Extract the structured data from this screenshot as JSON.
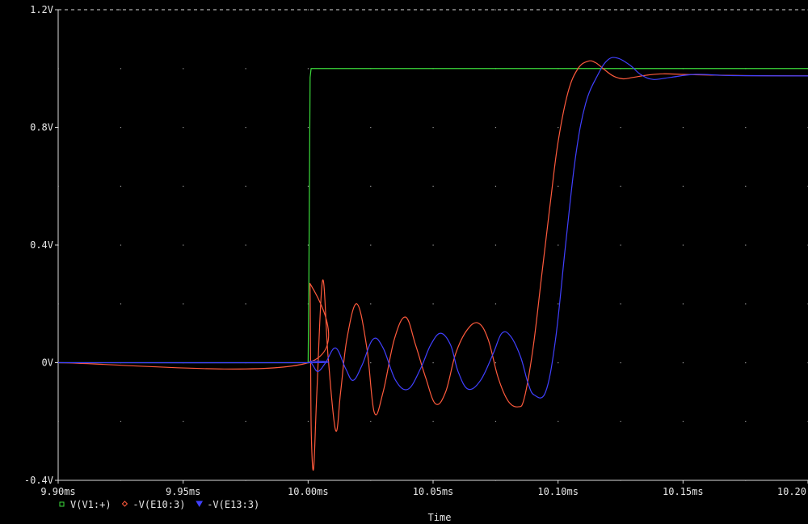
{
  "chart_data": {
    "type": "line",
    "xlabel": "Time",
    "ylabel": "",
    "xlim": [
      9.9,
      10.2
    ],
    "ylim": [
      -0.4,
      1.2
    ],
    "x_ticks": [
      {
        "value": 9.9,
        "label": "9.90ms"
      },
      {
        "value": 9.95,
        "label": "9.95ms"
      },
      {
        "value": 10.0,
        "label": "10.00ms"
      },
      {
        "value": 10.05,
        "label": "10.05ms"
      },
      {
        "value": 10.1,
        "label": "10.10ms"
      },
      {
        "value": 10.15,
        "label": "10.15ms"
      },
      {
        "value": 10.2,
        "label": "10.20"
      }
    ],
    "y_ticks": [
      {
        "value": 1.2,
        "label": "1.2V"
      },
      {
        "value": 0.8,
        "label": "0.8V"
      },
      {
        "value": 0.4,
        "label": "0.4V"
      },
      {
        "value": 0.0,
        "label": "0V"
      },
      {
        "value": -0.4,
        "label": "-0.4V"
      }
    ],
    "grid": true,
    "legend_position": "bottom-left",
    "series": [
      {
        "name": "V(V1:+)",
        "marker": "square",
        "color": "#3cdc3c",
        "x": [
          9.9,
          10.0,
          10.0003,
          10.0008,
          10.0012,
          10.002,
          10.2
        ],
        "y": [
          0.0,
          0.0,
          0.28,
          0.97,
          1.0,
          1.0,
          1.0
        ]
      },
      {
        "name": "-V(E10:3)",
        "marker": "diamond",
        "color": "#ff5a3c",
        "x": [
          9.9,
          10.0,
          10.0007,
          10.001,
          10.0013,
          10.0022,
          10.0035,
          10.0058,
          10.008,
          10.011,
          10.013,
          10.0155,
          10.0195,
          10.0235,
          10.0265,
          10.03,
          10.0345,
          10.039,
          10.043,
          10.047,
          10.051,
          10.055,
          10.059,
          10.0635,
          10.068,
          10.072,
          10.076,
          10.08,
          10.084,
          10.0865,
          10.09,
          10.0935,
          10.097,
          10.1,
          10.104,
          10.108,
          10.112,
          10.115,
          10.118,
          10.122,
          10.126,
          10.13,
          10.136,
          10.142,
          10.15,
          10.16,
          10.175,
          10.2
        ],
        "y": [
          0.0,
          0.0,
          0.27,
          0.0,
          -0.25,
          -0.36,
          -0.1,
          0.28,
          0.02,
          -0.23,
          -0.1,
          0.08,
          0.2,
          0.05,
          -0.17,
          -0.1,
          0.08,
          0.155,
          0.06,
          -0.05,
          -0.14,
          -0.1,
          0.03,
          0.11,
          0.135,
          0.08,
          -0.05,
          -0.13,
          -0.15,
          -0.12,
          0.05,
          0.3,
          0.55,
          0.75,
          0.92,
          1.0,
          1.025,
          1.02,
          1.0,
          0.975,
          0.965,
          0.97,
          0.978,
          0.982,
          0.98,
          0.978,
          0.976,
          0.975
        ]
      },
      {
        "name": "-V(E13:3)",
        "marker": "triangle",
        "color": "#4040ff",
        "x": [
          9.9,
          10.0,
          10.0008,
          10.002,
          10.004,
          10.007,
          10.011,
          10.015,
          10.018,
          10.0215,
          10.026,
          10.03,
          10.035,
          10.04,
          10.045,
          10.049,
          10.053,
          10.057,
          10.06,
          10.064,
          10.069,
          10.074,
          10.0775,
          10.081,
          10.085,
          10.088,
          10.0905,
          10.095,
          10.099,
          10.103,
          10.107,
          10.111,
          10.116,
          10.12,
          10.124,
          10.129,
          10.133,
          10.138,
          10.145,
          10.155,
          10.17,
          10.2
        ],
        "y": [
          0.0,
          0.0,
          0.005,
          -0.01,
          -0.03,
          0.0,
          0.05,
          -0.02,
          -0.06,
          -0.01,
          0.08,
          0.05,
          -0.06,
          -0.09,
          -0.02,
          0.06,
          0.1,
          0.06,
          -0.03,
          -0.09,
          -0.06,
          0.03,
          0.1,
          0.09,
          0.02,
          -0.07,
          -0.11,
          -0.1,
          0.08,
          0.4,
          0.7,
          0.88,
          0.98,
          1.03,
          1.035,
          1.01,
          0.98,
          0.963,
          0.97,
          0.98,
          0.976,
          0.975
        ]
      }
    ]
  }
}
